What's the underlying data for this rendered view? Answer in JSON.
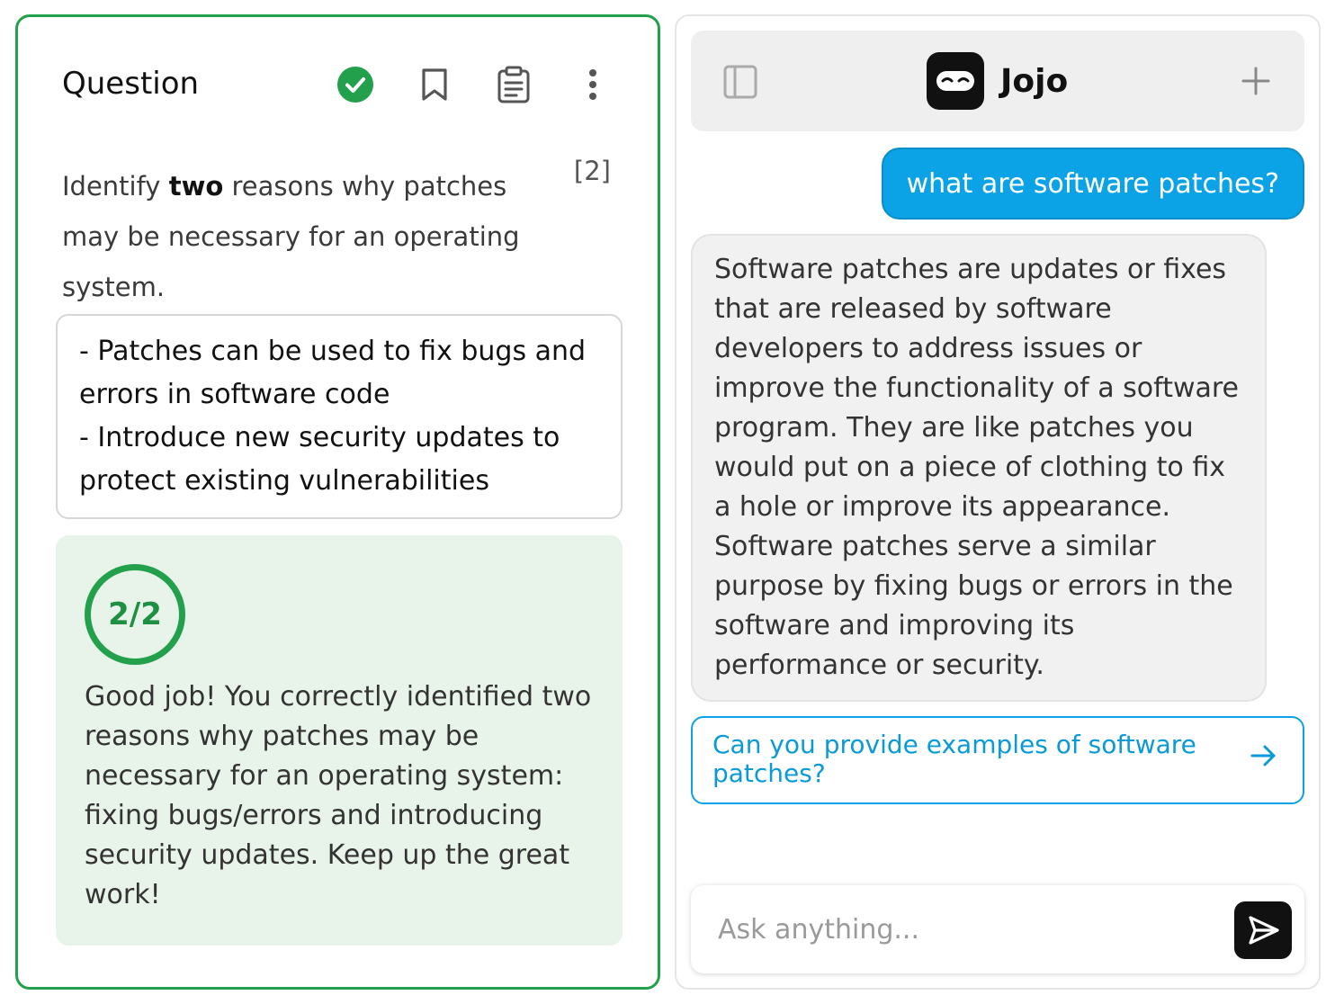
{
  "question": {
    "title": "Question",
    "text_before": "Identify ",
    "text_bold": "two",
    "text_after": " reasons why patches may be necessary for an operating system.",
    "marks": "[2]",
    "answer": "- Patches can be used to fix bugs and errors in software code\n- Introduce new security updates to protect existing vulnerabilities",
    "score": "2/2",
    "feedback": "Good job! You correctly identified two reasons why patches may be necessary for an operating system: fixing bugs/errors and introducing security updates. Keep up the great work!",
    "icons": [
      "check-circle-icon",
      "bookmark-icon",
      "clipboard-icon",
      "more-vertical-icon"
    ]
  },
  "chat": {
    "brand": "Jojo",
    "user_message": "what are software patches?",
    "bot_message": "Software patches are updates or fixes that are released by software developers to address issues or improve the functionality of a software program. They are like patches you would put on a piece of clothing to fix a hole or improve its appearance. Software patches serve a similar purpose by fixing bugs or errors in the software and improving its performance or security.",
    "suggestion": "Can you provide examples of software patches?",
    "input_placeholder": "Ask anything...",
    "input_value": ""
  },
  "colors": {
    "success": "#22a04b",
    "accent": "#0ca2e6",
    "feedback_bg": "#e8f3ea"
  }
}
